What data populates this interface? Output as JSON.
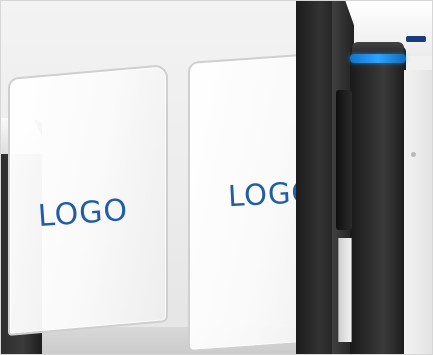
{
  "photo": {
    "glass_left_label": "LOGO",
    "glass_right_label": "LOGO"
  },
  "colors": {
    "logo_text": "#1f5da6",
    "indicator_ring": "#2ea3ff",
    "pillar": "#2a2a2a"
  }
}
